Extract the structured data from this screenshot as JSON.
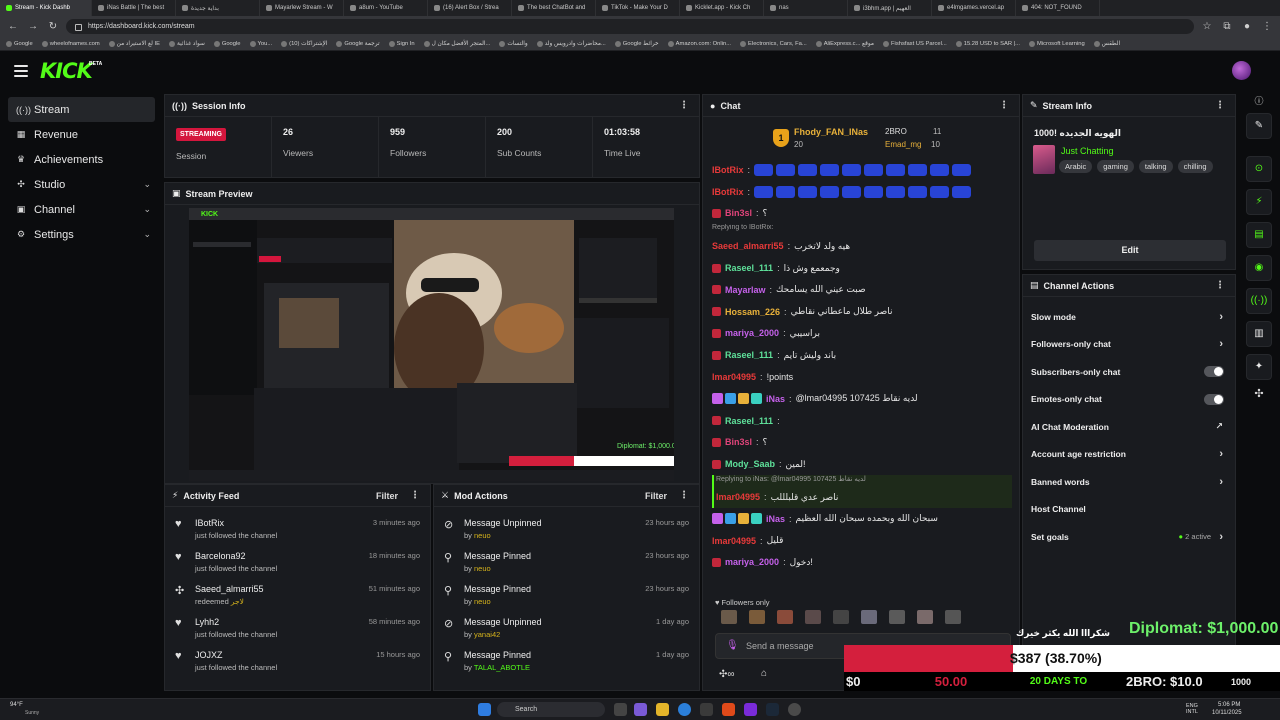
{
  "browser": {
    "tabs": [
      {
        "label": "Stream - Kick Dashb",
        "active": true
      },
      {
        "label": "iNas Battle | The best"
      },
      {
        "label": "بداية جديدة"
      },
      {
        "label": "Mayarlew Stream - W"
      },
      {
        "label": "a8um - YouTube"
      },
      {
        "label": "(16) Alert Box / Strea"
      },
      {
        "label": "The best ChatBot and"
      },
      {
        "label": "TikTok - Make Your D"
      },
      {
        "label": "Kicklet.app - Kick Ch"
      },
      {
        "label": "nas"
      },
      {
        "label": "i3bhm.app | العهيم"
      },
      {
        "label": "e4lmgames.vercel.ap"
      },
      {
        "label": "404: NOT_FOUND"
      }
    ],
    "url": "https://dashboard.kick.com/stream",
    "bookmarks": [
      "Google",
      "wheelofnames.com",
      "لغ الاستيراد من IE",
      "سواد غذائية",
      "Google",
      "You...",
      "(10) الإشتراكات",
      "Google ترجمة",
      "Sign In",
      "المتجر الأفضل مكان ل...",
      "والتسات",
      "محاضرات وادرويس ولد...",
      "Google خرائط",
      "Amazon.com: Onlin...",
      "Electronics, Cars, Fa...",
      "AliExpress.c... موقع",
      "Fishsfast US Parcel...",
      "15.28 USD to SAR |...",
      "Microsoft Learning",
      "الطقس"
    ]
  },
  "header": {
    "logo": "KICK",
    "beta": "BETA"
  },
  "sidebar": {
    "items": [
      {
        "label": "Stream",
        "icon": "broadcast-icon",
        "active": true
      },
      {
        "label": "Revenue",
        "icon": "revenue-icon"
      },
      {
        "label": "Achievements",
        "icon": "trophy-icon"
      },
      {
        "label": "Studio",
        "icon": "studio-icon",
        "chevron": true
      },
      {
        "label": "Channel",
        "icon": "channel-icon",
        "chevron": true
      },
      {
        "label": "Settings",
        "icon": "gear-icon",
        "chevron": true
      }
    ]
  },
  "session": {
    "title": "Session Info",
    "status": "STREAMING",
    "status_label": "Session",
    "stats": [
      {
        "value": "26",
        "label": "Viewers"
      },
      {
        "value": "959",
        "label": "Followers"
      },
      {
        "value": "200",
        "label": "Sub Counts"
      },
      {
        "value": "01:03:58",
        "label": "Time Live"
      }
    ]
  },
  "preview": {
    "title": "Stream Preview"
  },
  "activity": {
    "title": "Activity Feed",
    "filter": "Filter",
    "items": [
      {
        "name": "IBotRix",
        "sub": "just followed the channel",
        "time": "3 minutes ago",
        "icon": "heart-icon"
      },
      {
        "name": "Barcelona92",
        "sub": "just followed the channel",
        "time": "18 minutes ago",
        "icon": "heart-icon"
      },
      {
        "name": "Saeed_almarri55",
        "sub": "redeemed",
        "extra": "لاجر",
        "time": "51 minutes ago",
        "icon": "redeem-icon"
      },
      {
        "name": "Lyhh2",
        "sub": "just followed the channel",
        "time": "58 minutes ago",
        "icon": "heart-icon"
      },
      {
        "name": "JOJXZ",
        "sub": "just followed the channel",
        "time": "15 hours ago",
        "icon": "heart-icon"
      }
    ]
  },
  "mod": {
    "title": "Mod Actions",
    "filter": "Filter",
    "items": [
      {
        "name": "Message Unpinned",
        "by": "by",
        "user": "neuo",
        "time": "23 hours ago",
        "icon": "unpin-icon"
      },
      {
        "name": "Message Pinned",
        "by": "by",
        "user": "neuo",
        "time": "23 hours ago",
        "icon": "pin-icon"
      },
      {
        "name": "Message Pinned",
        "by": "by",
        "user": "neuo",
        "time": "23 hours ago",
        "icon": "pin-icon"
      },
      {
        "name": "Message Unpinned",
        "by": "by",
        "user": "yanai42",
        "time": "1 day ago",
        "icon": "unpin-icon"
      },
      {
        "name": "Message Pinned",
        "by": "by",
        "user": "TALAL_ABOTLE",
        "time": "1 day ago",
        "icon": "pin-icon"
      }
    ]
  },
  "chat": {
    "title": "Chat",
    "leaderboard": [
      {
        "rank": "1",
        "name": "Fhody_FAN_INas",
        "count": "20"
      },
      {
        "name": "2BRO",
        "count": "11"
      },
      {
        "name": "Emad_mg",
        "count": "10"
      }
    ],
    "messages": [
      {
        "user": "IBotRix",
        "color": "#e83a3a",
        "emotes": 10,
        "text": ""
      },
      {
        "user": "IBotRix",
        "color": "#e83a3a",
        "emotes": 10,
        "text": ""
      },
      {
        "user": "Bin3sl",
        "color": "#e0447a",
        "badge": true,
        "text": "؟"
      },
      {
        "reply": "Replying to IBotRix:",
        "user": "Saeed_almarri55",
        "color": "#e83a3a",
        "text": "هيه ولد لاتخرب"
      },
      {
        "user": "Raseel_111",
        "color": "#5ee09a",
        "badge": true,
        "text": "وجمعمع وش ذا"
      },
      {
        "user": "Mayarlaw",
        "color": "#c561ea",
        "badge": true,
        "text": "صبت عيني الله يسامحك"
      },
      {
        "user": "Hossam_226",
        "color": "#e8b13a",
        "badge": true,
        "text": "ناصر طلال ماعطاني نقاطي"
      },
      {
        "user": "mariya_2000",
        "color": "#c561ea",
        "badge": true,
        "text": "براسيبي"
      },
      {
        "user": "Raseel_111",
        "color": "#5ee09a",
        "badge": true,
        "text": "باند وليش تايم"
      },
      {
        "user": "lmar04995",
        "color": "#e83a3a",
        "text": "!points"
      },
      {
        "user": "iNas",
        "color": "#c561ea",
        "badges4": true,
        "text": "@lmar04995 107425 لديه نقاط"
      },
      {
        "user": "Raseel_111",
        "color": "#5ee09a",
        "badge": true,
        "text": ""
      },
      {
        "user": "Bin3sl",
        "color": "#e0447a",
        "badge": true,
        "text": "؟"
      },
      {
        "user": "Mody_Saab",
        "color": "#5ee09a",
        "badge": true,
        "text": "لمين!"
      },
      {
        "reply": "Replying to iNas: @lmar04995 107425 لديه نقاط",
        "user": "lmar04995",
        "color": "#e83a3a",
        "text": "ناصر عدي قلبلللب",
        "highlight": true
      },
      {
        "user": "iNas",
        "color": "#c561ea",
        "badges4": true,
        "text": "سبحان الله وبحمده سبحان الله العظيم"
      },
      {
        "user": "lmar04995",
        "color": "#e83a3a",
        "text": "قليل"
      },
      {
        "user": "mariya_2000",
        "color": "#c561ea",
        "badge": true,
        "text": "دخول!"
      }
    ],
    "followers_only": "Followers only",
    "input_placeholder": "Send a message"
  },
  "stream_info": {
    "title": "Stream Info",
    "stream_title": "الهويه الجديده !1000",
    "category": "Just Chatting",
    "tags": [
      "Arabic",
      "gaming",
      "talking",
      "chilling"
    ],
    "edit": "Edit"
  },
  "channel_actions": {
    "title": "Channel Actions",
    "items": [
      {
        "label": "Slow mode",
        "kind": "chevron"
      },
      {
        "label": "Followers-only chat",
        "kind": "chevron"
      },
      {
        "label": "Subscribers-only chat",
        "kind": "toggle"
      },
      {
        "label": "Emotes-only chat",
        "kind": "toggle"
      },
      {
        "label": "AI Chat Moderation",
        "kind": "external"
      },
      {
        "label": "Account age restriction",
        "kind": "chevron"
      },
      {
        "label": "Banned words",
        "kind": "chevron"
      },
      {
        "label": "Host Channel",
        "kind": "none"
      },
      {
        "label": "Set goals",
        "kind": "chevron",
        "status": "2 active"
      }
    ]
  },
  "overlay": {
    "diplomat": "Diplomat: $1,000.00",
    "thanks": "شكرااا الله يكثر خيرك",
    "progress_pct": 0.387,
    "progress_text": "$387 (38.70%)",
    "bottom": [
      "$0",
      "50.00",
      "20 DAYS TO",
      "2BRO: $10.0",
      "1000"
    ]
  },
  "taskbar": {
    "weather": "94°F",
    "weather_sub": "Sunny",
    "search": "Search",
    "lang": "ENG INTL",
    "time": "5:06 PM",
    "date": "10/11/2025"
  },
  "colors": {
    "kick_green": "#53fc18",
    "streaming_red": "#d4163d",
    "panel": "#191b1f",
    "bg": "#0b0c0e"
  }
}
